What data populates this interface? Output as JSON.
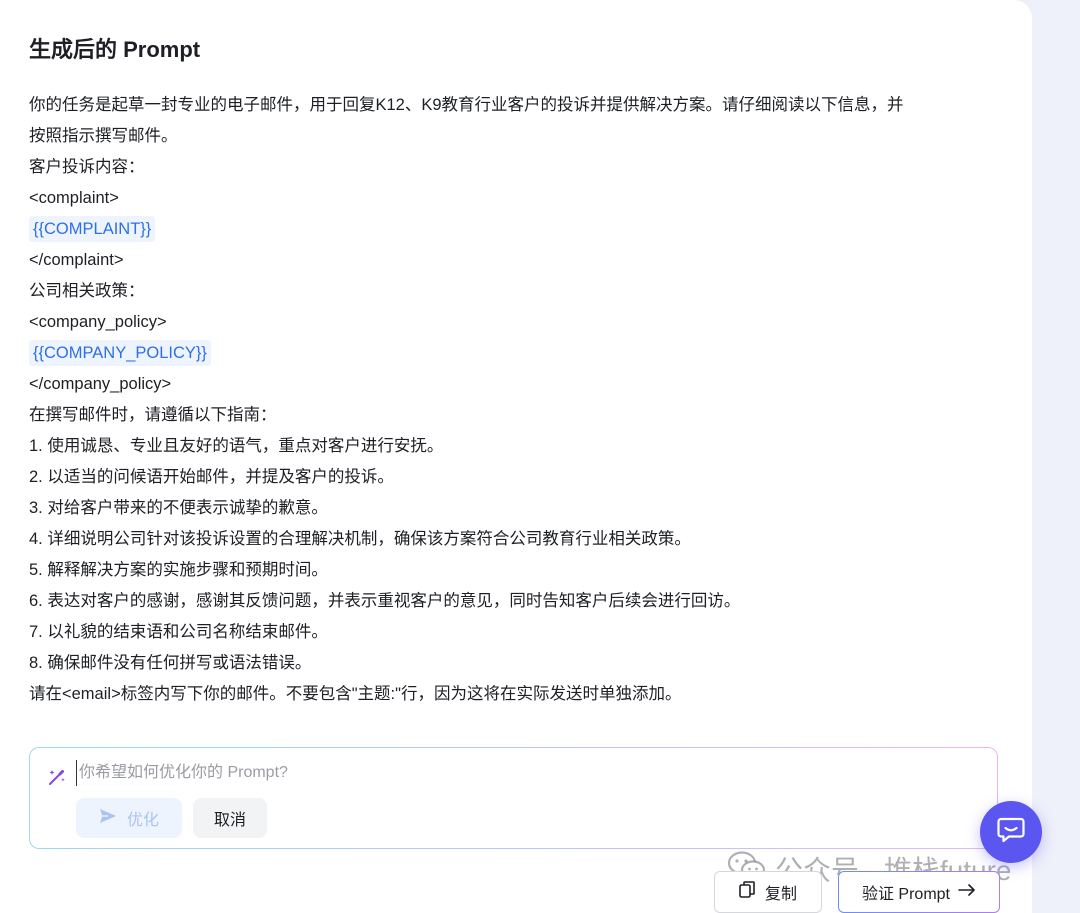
{
  "title": "生成后的 Prompt",
  "prompt_lines": {
    "l0": "你的任务是起草一封专业的电子邮件，用于回复K12、K9教育行业客户的投诉并提供解决方案。请仔细阅读以下信息，并",
    "l1": "按照指示撰写邮件。",
    "l2": "客户投诉内容：",
    "l3": "<complaint>",
    "l4": "{{COMPLAINT}}",
    "l5": "</complaint>",
    "l6": "公司相关政策：",
    "l7": "<company_policy>",
    "l8": "{{COMPANY_POLICY}}",
    "l9": "</company_policy>",
    "l10": "在撰写邮件时，请遵循以下指南：",
    "l11": "1. 使用诚恳、专业且友好的语气，重点对客户进行安抚。",
    "l12": "2. 以适当的问候语开始邮件，并提及客户的投诉。",
    "l13": "3. 对给客户带来的不便表示诚挚的歉意。",
    "l14": "4. 详细说明公司针对该投诉设置的合理解决机制，确保该方案符合公司教育行业相关政策。",
    "l15": "5. 解释解决方案的实施步骤和预期时间。",
    "l16": "6. 表达对客户的感谢，感谢其反馈问题，并表示重视客户的意见，同时告知客户后续会进行回访。",
    "l17": "7. 以礼貌的结束语和公司名称结束邮件。",
    "l18": "8. 确保邮件没有任何拼写或语法错误。",
    "l19": "请在<email>标签内写下你的邮件。不要包含\"主题:\"行，因为这将在实际发送时单独添加。"
  },
  "optimize_box": {
    "placeholder": "你希望如何优化你的 Prompt?",
    "optimize_label": "优化",
    "cancel_label": "取消"
  },
  "actions": {
    "copy_label": "复制",
    "verify_label": "验证 Prompt"
  },
  "watermark": {
    "text": "公众号 · 堆栈future"
  },
  "icons": {
    "wand": "magic-wand-icon",
    "send": "send-icon",
    "copy": "copy-icon",
    "arrow": "arrow-right-icon",
    "chat": "chat-icon",
    "wechat": "wechat-icon"
  },
  "colors": {
    "accent_blue": "#2f6fe6",
    "fab_purple": "#5b56f0",
    "chip_bg": "#eef4fe"
  }
}
